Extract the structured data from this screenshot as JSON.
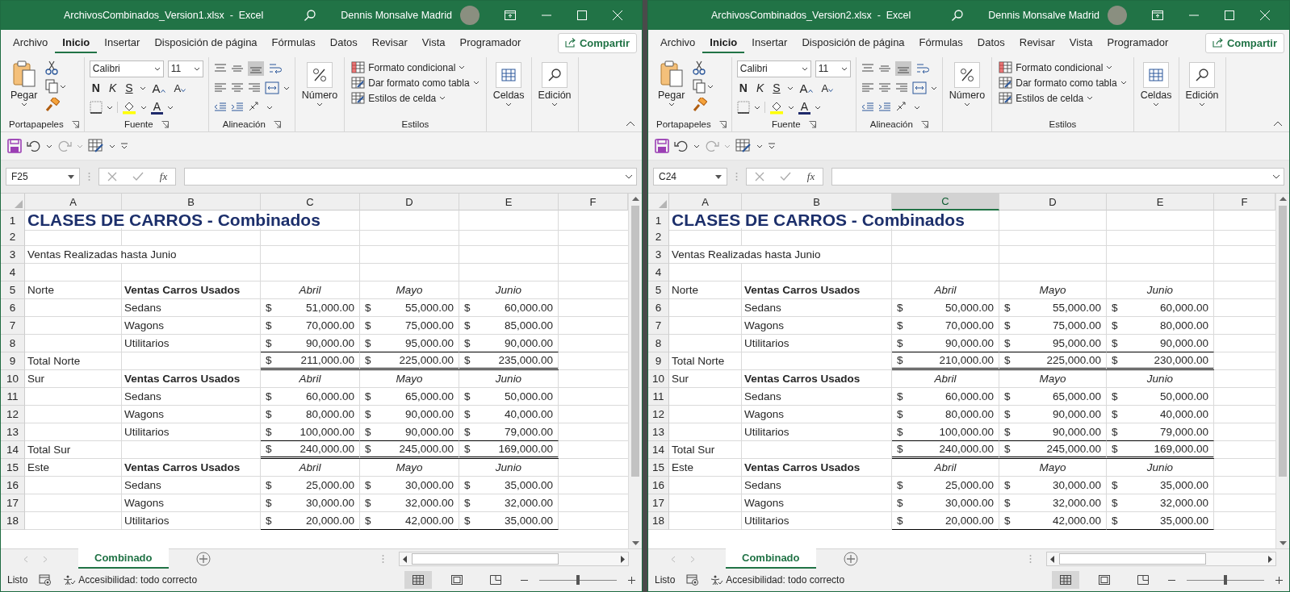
{
  "windows": [
    {
      "title": "ArchivosCombinados_Version1.xlsx  -  Excel",
      "user": "Dennis Monsalve Madrid",
      "menu_tabs": [
        {
          "label": "Archivo",
          "selected": false
        },
        {
          "label": "Inicio",
          "selected": true
        },
        {
          "label": "Insertar",
          "selected": false
        },
        {
          "label": "Disposición de página",
          "selected": false
        },
        {
          "label": "Fórmulas",
          "selected": false
        },
        {
          "label": "Datos",
          "selected": false
        },
        {
          "label": "Revisar",
          "selected": false
        },
        {
          "label": "Vista",
          "selected": false
        },
        {
          "label": "Programador",
          "selected": false
        }
      ],
      "share": "Compartir",
      "ribbon": [
        {
          "kind": "clipboard",
          "label": "Portapapeles",
          "button": "Pegar"
        },
        {
          "kind": "font",
          "label": "Fuente",
          "font_name": "Calibri",
          "font_size": "11",
          "styles": [
            "N",
            "K",
            "S"
          ],
          "grow": "A",
          "shrink": "A",
          "font_color": "A"
        },
        {
          "kind": "alignment",
          "label": "Alineación"
        },
        {
          "kind": "number",
          "button": "Número"
        },
        {
          "kind": "styles",
          "label": "Estilos",
          "items": [
            "Formato condicional",
            "Dar formato como tabla",
            "Estilos de celda"
          ]
        },
        {
          "kind": "cells",
          "button": "Celdas"
        },
        {
          "kind": "editing",
          "button": "Edición"
        }
      ],
      "name_box": "F25",
      "fx": "fx",
      "columns": [
        {
          "label": "A",
          "selected": false
        },
        {
          "label": "B",
          "selected": false
        },
        {
          "label": "C",
          "selected": false
        },
        {
          "label": "D",
          "selected": false
        },
        {
          "label": "E",
          "selected": false
        },
        {
          "label": "F",
          "selected": false
        }
      ],
      "rows": [
        {
          "n": "1",
          "kind": "title",
          "a": "CLASES DE CARROS - Combinados"
        },
        {
          "n": "2",
          "kind": "blank"
        },
        {
          "n": "3",
          "kind": "text",
          "a": "Ventas Realizadas hasta Junio"
        },
        {
          "n": "4",
          "kind": "blank"
        },
        {
          "n": "5",
          "kind": "header",
          "a": "Norte",
          "b": "Ventas Carros Usados",
          "months": [
            "Abril",
            "Mayo",
            "Junio"
          ]
        },
        {
          "n": "6",
          "kind": "item",
          "b": "Sedans",
          "values": [
            [
              "$",
              "51,000.00"
            ],
            [
              "$",
              "55,000.00"
            ],
            [
              "$",
              "60,000.00"
            ]
          ]
        },
        {
          "n": "7",
          "kind": "item",
          "b": "Wagons",
          "values": [
            [
              "$",
              "70,000.00"
            ],
            [
              "$",
              "75,000.00"
            ],
            [
              "$",
              "85,000.00"
            ]
          ]
        },
        {
          "n": "8",
          "kind": "item_last",
          "b": "Utilitarios",
          "values": [
            [
              "$",
              "90,000.00"
            ],
            [
              "$",
              "95,000.00"
            ],
            [
              "$",
              "90,000.00"
            ]
          ]
        },
        {
          "n": "9",
          "kind": "total",
          "a": "Total Norte",
          "values": [
            [
              "$",
              "211,000.00"
            ],
            [
              "$",
              "225,000.00"
            ],
            [
              "$",
              "235,000.00"
            ]
          ]
        },
        {
          "n": "10",
          "kind": "header",
          "a": "Sur",
          "b": "Ventas Carros Usados",
          "months": [
            "Abril",
            "Mayo",
            "Junio"
          ]
        },
        {
          "n": "11",
          "kind": "item",
          "b": "Sedans",
          "values": [
            [
              "$",
              "60,000.00"
            ],
            [
              "$",
              "65,000.00"
            ],
            [
              "$",
              "50,000.00"
            ]
          ]
        },
        {
          "n": "12",
          "kind": "item",
          "b": "Wagons",
          "values": [
            [
              "$",
              "80,000.00"
            ],
            [
              "$",
              "90,000.00"
            ],
            [
              "$",
              "40,000.00"
            ]
          ]
        },
        {
          "n": "13",
          "kind": "item_last",
          "b": "Utilitarios",
          "values": [
            [
              "$",
              "100,000.00"
            ],
            [
              "$",
              "90,000.00"
            ],
            [
              "$",
              "79,000.00"
            ]
          ]
        },
        {
          "n": "14",
          "kind": "total",
          "a": "Total Sur",
          "values": [
            [
              "$",
              "240,000.00"
            ],
            [
              "$",
              "245,000.00"
            ],
            [
              "$",
              "169,000.00"
            ]
          ]
        },
        {
          "n": "15",
          "kind": "header",
          "a": "Este",
          "b": "Ventas Carros Usados",
          "months": [
            "Abril",
            "Mayo",
            "Junio"
          ]
        },
        {
          "n": "16",
          "kind": "item",
          "b": "Sedans",
          "values": [
            [
              "$",
              "25,000.00"
            ],
            [
              "$",
              "30,000.00"
            ],
            [
              "$",
              "35,000.00"
            ]
          ]
        },
        {
          "n": "17",
          "kind": "item",
          "b": "Wagons",
          "values": [
            [
              "$",
              "30,000.00"
            ],
            [
              "$",
              "32,000.00"
            ],
            [
              "$",
              "32,000.00"
            ]
          ]
        },
        {
          "n": "18",
          "kind": "item_last",
          "b": "Utilitarios",
          "values": [
            [
              "$",
              "20,000.00"
            ],
            [
              "$",
              "42,000.00"
            ],
            [
              "$",
              "35,000.00"
            ]
          ]
        }
      ],
      "sheet_tabs": [
        {
          "label": "Combinado",
          "selected": true
        }
      ],
      "status": "Listo",
      "accessibility": "Accesibilidad: todo correcto",
      "zoom": {
        "level": 0.5
      }
    },
    {
      "title": "ArchivosCombinados_Version2.xlsx  -  Excel",
      "user": "Dennis Monsalve Madrid",
      "menu_tabs": [
        {
          "label": "Archivo",
          "selected": false
        },
        {
          "label": "Inicio",
          "selected": true
        },
        {
          "label": "Insertar",
          "selected": false
        },
        {
          "label": "Disposición de página",
          "selected": false
        },
        {
          "label": "Fórmulas",
          "selected": false
        },
        {
          "label": "Datos",
          "selected": false
        },
        {
          "label": "Revisar",
          "selected": false
        },
        {
          "label": "Vista",
          "selected": false
        },
        {
          "label": "Programador",
          "selected": false
        }
      ],
      "share": "Compartir",
      "ribbon": [
        {
          "kind": "clipboard",
          "label": "Portapapeles",
          "button": "Pegar"
        },
        {
          "kind": "font",
          "label": "Fuente",
          "font_name": "Calibri",
          "font_size": "11",
          "styles": [
            "N",
            "K",
            "S"
          ],
          "grow": "A",
          "shrink": "A",
          "font_color": "A"
        },
        {
          "kind": "alignment",
          "label": "Alineación"
        },
        {
          "kind": "number",
          "button": "Número"
        },
        {
          "kind": "styles",
          "label": "Estilos",
          "items": [
            "Formato condicional",
            "Dar formato como tabla",
            "Estilos de celda"
          ]
        },
        {
          "kind": "cells",
          "button": "Celdas"
        },
        {
          "kind": "editing",
          "button": "Edición"
        }
      ],
      "name_box": "C24",
      "fx": "fx",
      "columns": [
        {
          "label": "A",
          "selected": false
        },
        {
          "label": "B",
          "selected": false
        },
        {
          "label": "C",
          "selected": true
        },
        {
          "label": "D",
          "selected": false
        },
        {
          "label": "E",
          "selected": false
        },
        {
          "label": "F",
          "selected": false
        }
      ],
      "rows": [
        {
          "n": "1",
          "kind": "title",
          "a": "CLASES DE CARROS - Combinados"
        },
        {
          "n": "2",
          "kind": "blank"
        },
        {
          "n": "3",
          "kind": "text",
          "a": "Ventas Realizadas hasta Junio"
        },
        {
          "n": "4",
          "kind": "blank"
        },
        {
          "n": "5",
          "kind": "header",
          "a": "Norte",
          "b": "Ventas Carros Usados",
          "months": [
            "Abril",
            "Mayo",
            "Junio"
          ]
        },
        {
          "n": "6",
          "kind": "item",
          "b": "Sedans",
          "values": [
            [
              "$",
              "50,000.00"
            ],
            [
              "$",
              "55,000.00"
            ],
            [
              "$",
              "60,000.00"
            ]
          ]
        },
        {
          "n": "7",
          "kind": "item",
          "b": "Wagons",
          "values": [
            [
              "$",
              "70,000.00"
            ],
            [
              "$",
              "75,000.00"
            ],
            [
              "$",
              "80,000.00"
            ]
          ]
        },
        {
          "n": "8",
          "kind": "item_last",
          "b": "Utilitarios",
          "values": [
            [
              "$",
              "90,000.00"
            ],
            [
              "$",
              "95,000.00"
            ],
            [
              "$",
              "90,000.00"
            ]
          ]
        },
        {
          "n": "9",
          "kind": "total",
          "a": "Total Norte",
          "values": [
            [
              "$",
              "210,000.00"
            ],
            [
              "$",
              "225,000.00"
            ],
            [
              "$",
              "230,000.00"
            ]
          ]
        },
        {
          "n": "10",
          "kind": "header",
          "a": "Sur",
          "b": "Ventas Carros Usados",
          "months": [
            "Abril",
            "Mayo",
            "Junio"
          ]
        },
        {
          "n": "11",
          "kind": "item",
          "b": "Sedans",
          "values": [
            [
              "$",
              "60,000.00"
            ],
            [
              "$",
              "65,000.00"
            ],
            [
              "$",
              "50,000.00"
            ]
          ]
        },
        {
          "n": "12",
          "kind": "item",
          "b": "Wagons",
          "values": [
            [
              "$",
              "80,000.00"
            ],
            [
              "$",
              "90,000.00"
            ],
            [
              "$",
              "40,000.00"
            ]
          ]
        },
        {
          "n": "13",
          "kind": "item_last",
          "b": "Utilitarios",
          "values": [
            [
              "$",
              "100,000.00"
            ],
            [
              "$",
              "90,000.00"
            ],
            [
              "$",
              "79,000.00"
            ]
          ]
        },
        {
          "n": "14",
          "kind": "total",
          "a": "Total Sur",
          "values": [
            [
              "$",
              "240,000.00"
            ],
            [
              "$",
              "245,000.00"
            ],
            [
              "$",
              "169,000.00"
            ]
          ]
        },
        {
          "n": "15",
          "kind": "header",
          "a": "Este",
          "b": "Ventas Carros Usados",
          "months": [
            "Abril",
            "Mayo",
            "Junio"
          ]
        },
        {
          "n": "16",
          "kind": "item",
          "b": "Sedans",
          "values": [
            [
              "$",
              "25,000.00"
            ],
            [
              "$",
              "30,000.00"
            ],
            [
              "$",
              "35,000.00"
            ]
          ]
        },
        {
          "n": "17",
          "kind": "item",
          "b": "Wagons",
          "values": [
            [
              "$",
              "30,000.00"
            ],
            [
              "$",
              "32,000.00"
            ],
            [
              "$",
              "32,000.00"
            ]
          ]
        },
        {
          "n": "18",
          "kind": "item_last",
          "b": "Utilitarios",
          "values": [
            [
              "$",
              "20,000.00"
            ],
            [
              "$",
              "42,000.00"
            ],
            [
              "$",
              "35,000.00"
            ]
          ]
        }
      ],
      "sheet_tabs": [
        {
          "label": "Combinado",
          "selected": true
        }
      ],
      "status": "Listo",
      "accessibility": "Accesibilidad: todo correcto",
      "zoom": {
        "level": 0.5
      }
    }
  ]
}
